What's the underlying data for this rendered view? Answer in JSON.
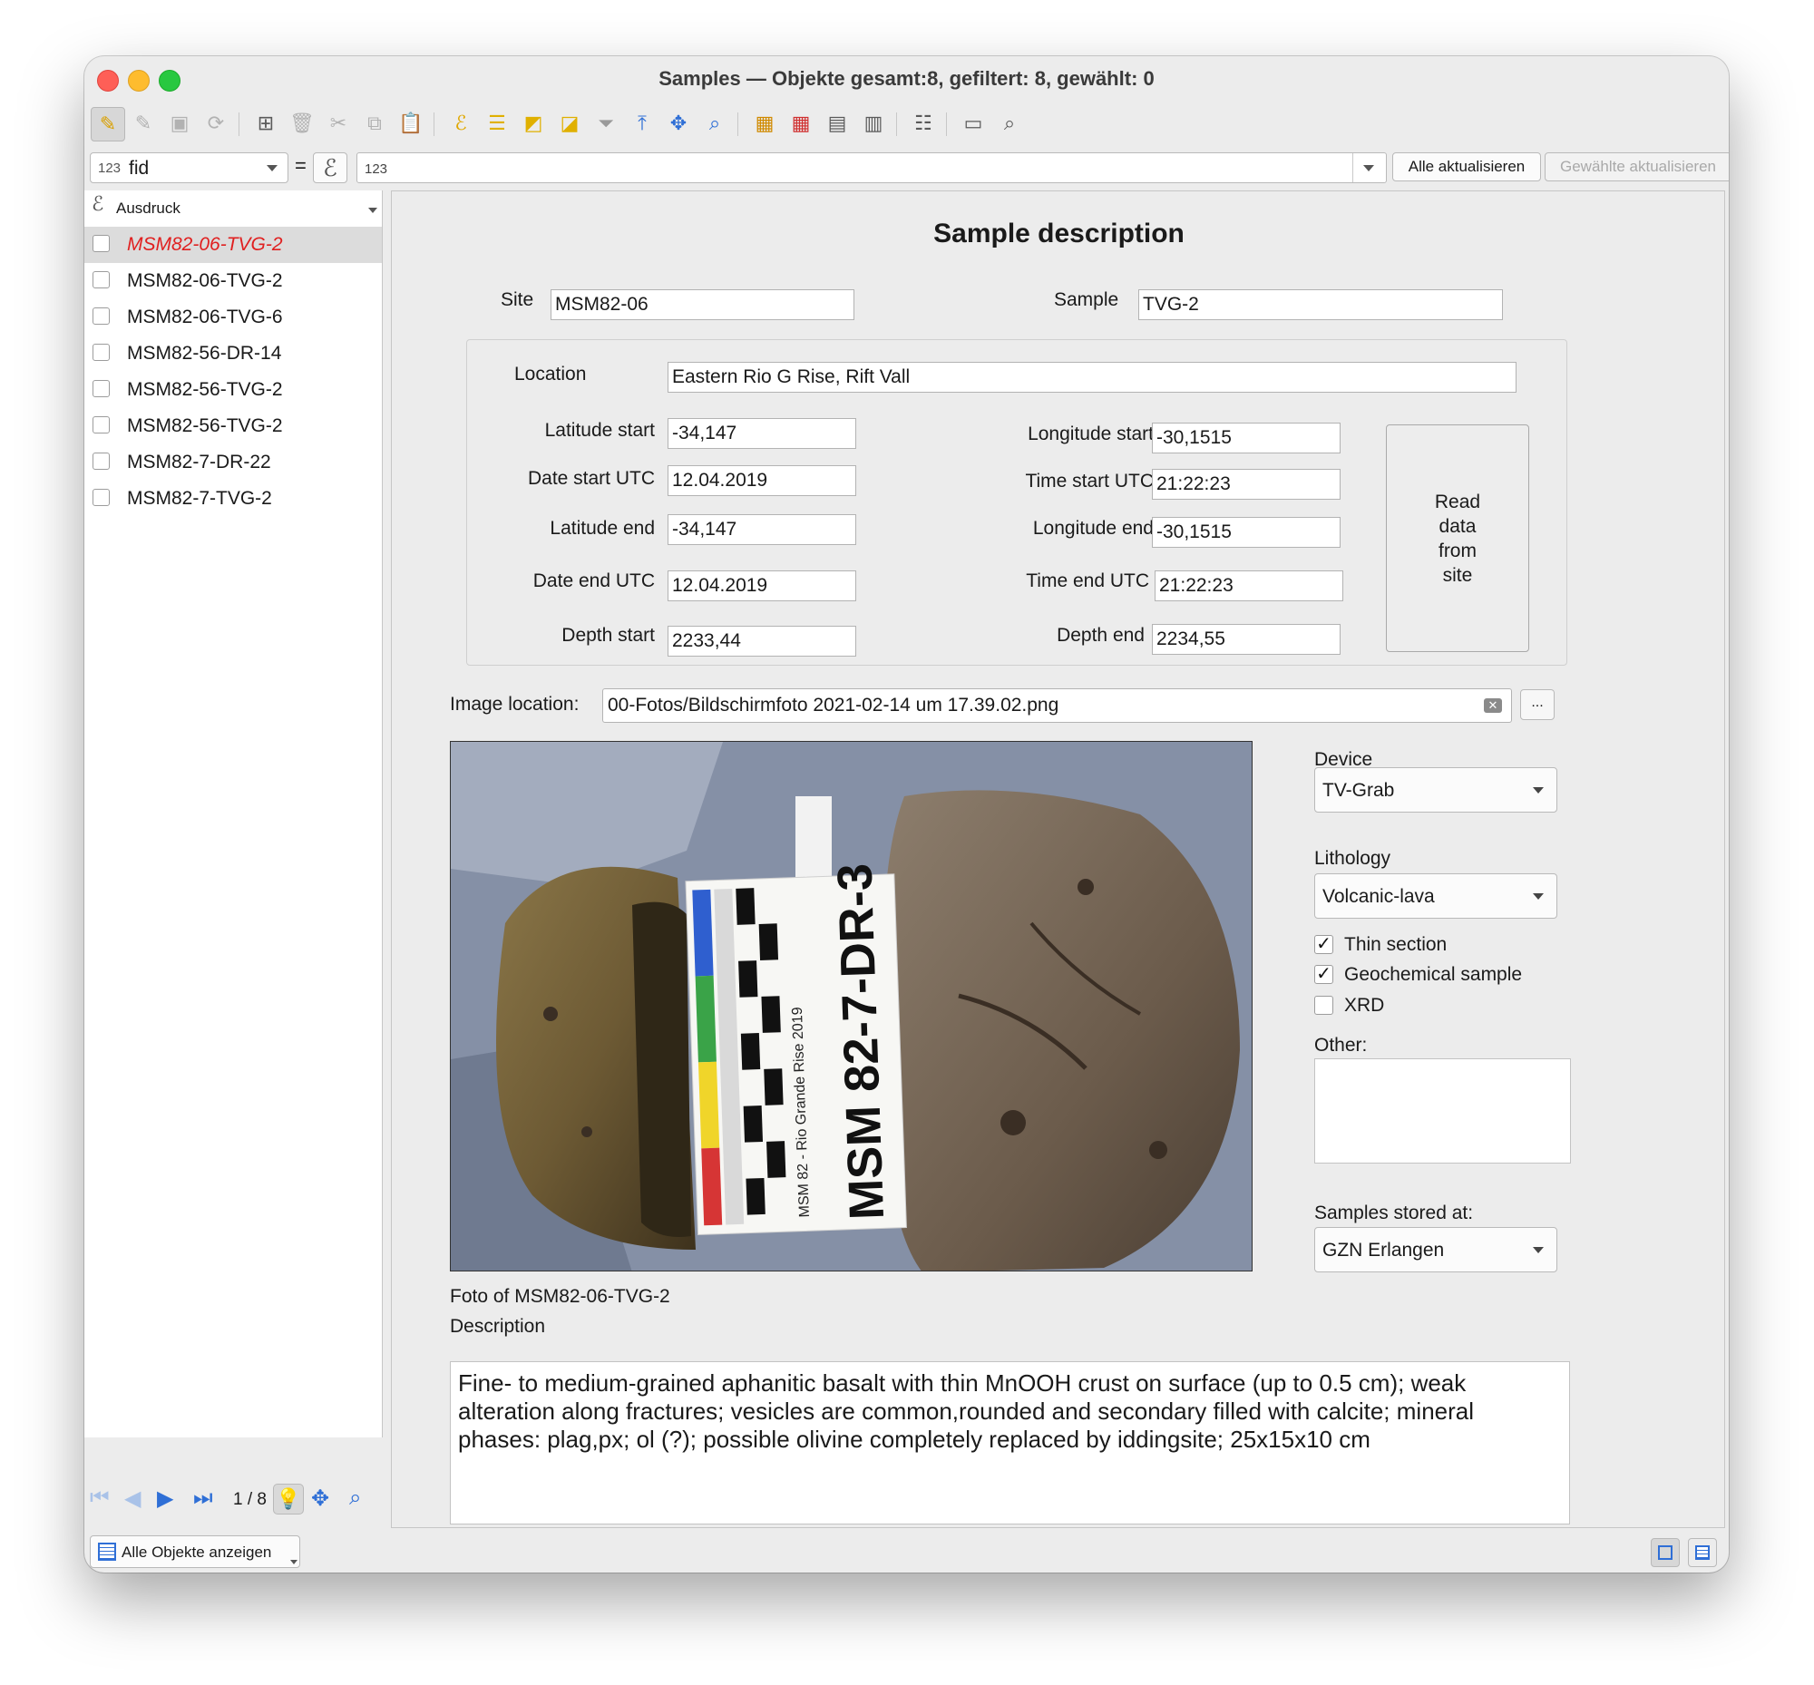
{
  "window": {
    "title": "Samples — Objekte gesamt:8, gefiltert: 8, gewählt: 0"
  },
  "toolbar": {
    "icons": [
      "pencil-icon",
      "multi-edit-icon",
      "save-icon",
      "reload-icon",
      "add-feature-icon",
      "delete-icon",
      "cut-icon",
      "copy-icon",
      "paste-icon",
      "expression-select-icon",
      "select-all-icon",
      "invert-selection-icon",
      "deselect-icon",
      "filter-icon",
      "move-to-top-icon",
      "pan-to-selection-icon",
      "zoom-to-selection-icon",
      "new-field-icon",
      "delete-field-icon",
      "field-calculator-icon",
      "conditional-formatting-icon",
      "dock-icon",
      "actions-icon",
      "search-zoom-icon"
    ]
  },
  "filter": {
    "field_prefix": "123",
    "field": "fid",
    "equals": "=",
    "epsilon": "ℰ",
    "value": "123",
    "update_all": "Alle aktualisieren",
    "update_selected": "Gewählte aktualisieren"
  },
  "list": {
    "header": "Ausdruck",
    "items": [
      {
        "name": "MSM82-06-TVG-2"
      },
      {
        "name": "MSM82-06-TVG-2"
      },
      {
        "name": "MSM82-06-TVG-6"
      },
      {
        "name": "MSM82-56-DR-14"
      },
      {
        "name": "MSM82-56-TVG-2"
      },
      {
        "name": "MSM82-56-TVG-2"
      },
      {
        "name": "MSM82-7-DR-22"
      },
      {
        "name": "MSM82-7-TVG-2"
      }
    ]
  },
  "nav": {
    "pager": "1 / 8",
    "show_all": "Alle Objekte anzeigen"
  },
  "form": {
    "title": "Sample description",
    "site_label": "Site",
    "site": "MSM82-06",
    "sample_label": "Sample",
    "sample": "TVG-2",
    "location_label": "Location",
    "location": "Eastern Rio G Rise, Rift Vall",
    "lat_start_label": "Latitude start",
    "lat_start": "-34,147",
    "lon_start_label": "Longitude start",
    "lon_start": "-30,1515",
    "date_start_label": "Date start UTC",
    "date_start": "12.04.2019",
    "time_start_label": "Time start UTC",
    "time_start": "21:22:23",
    "lat_end_label": "Latitude end",
    "lat_end": "-34,147",
    "lon_end_label": "Longitude end",
    "lon_end": "-30,1515",
    "date_end_label": "Date end UTC",
    "date_end": "12.04.2019",
    "time_end_label": "Time end UTC",
    "time_end": "21:22:23",
    "depth_start_label": "Depth start",
    "depth_start": "2233,44",
    "depth_end_label": "Depth end",
    "depth_end": "2234,55",
    "read_button": [
      "Read",
      "data",
      "from",
      "site"
    ],
    "image_location_label": "Image location:",
    "image_location": "00-Fotos/Bildschirmfoto 2021-02-14 um 17.39.02.png",
    "browse": "...",
    "photo_text": {
      "label": "MSM 82-7-DR-3",
      "scale": "MSM 82 - Rio Grande Rise 2019"
    },
    "caption": "Foto of MSM82-06-TVG-2",
    "description_label": "Description",
    "description": "Fine- to medium-grained aphanitic basalt with thin MnOOH crust on surface (up to 0.5 cm); weak alteration along fractures; vesicles are common,rounded and secondary filled with calcite; mineral phases: plag,px; ol (?); possible olivine completely replaced by iddingsite; 25x15x10 cm",
    "device_label": "Device",
    "device": "TV-Grab",
    "lithology_label": "Lithology",
    "lithology": "Volcanic-lava",
    "checks": [
      {
        "label": "Thin section",
        "checked": true
      },
      {
        "label": "Geochemical sample",
        "checked": true
      },
      {
        "label": "XRD",
        "checked": false
      }
    ],
    "other_label": "Other:",
    "stored_label": "Samples stored at:",
    "stored": "GZN Erlangen"
  }
}
